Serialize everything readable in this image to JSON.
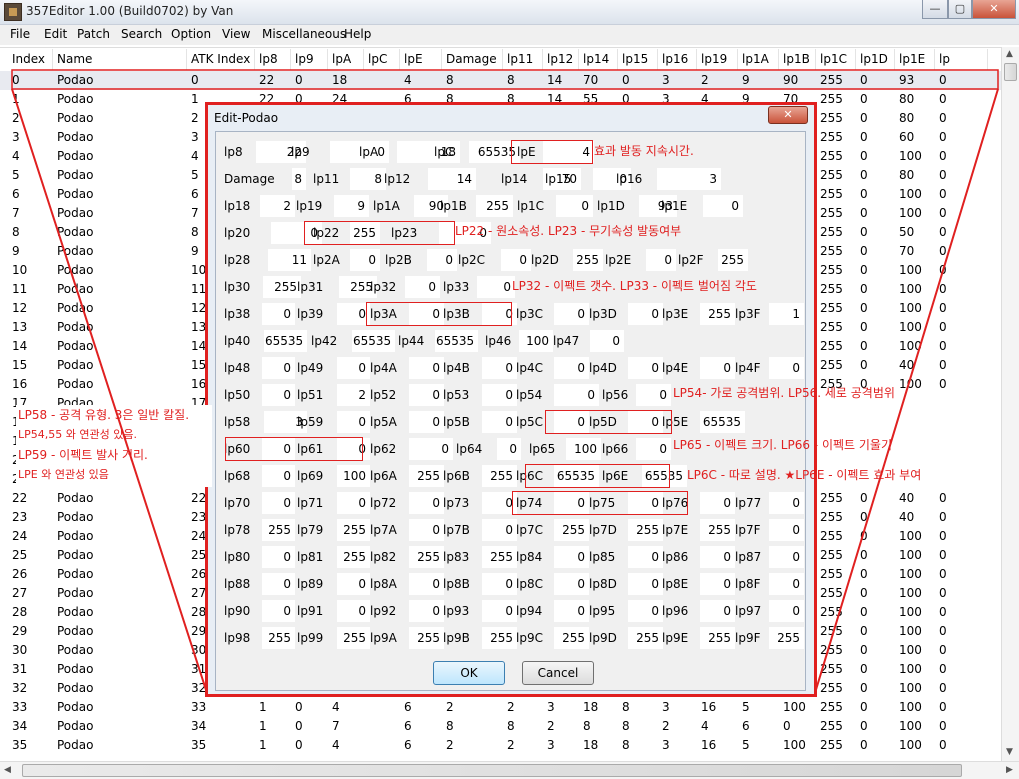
{
  "window": {
    "title": "357Editor 1.00 (Build0702) by Van",
    "min": "—",
    "max": "▢",
    "close": "✕"
  },
  "menu": [
    "File",
    "Edit",
    "Patch",
    "Search",
    "Option",
    "View",
    "Miscellaneous",
    "Help"
  ],
  "table": {
    "columns": [
      "Index",
      "Name",
      "ATK Index",
      "lp8",
      "lp9",
      "lpA",
      "lpC",
      "lpE",
      "Damage",
      "lp11",
      "lp12",
      "lp14",
      "lp15",
      "lp16",
      "lp19",
      "lp1A",
      "lp1B",
      "lp1C",
      "lp1D",
      "lp1E",
      "lp"
    ],
    "rows": [
      [
        "0",
        "Podao",
        "0",
        "22",
        "0",
        "18",
        "",
        "4",
        "8",
        "8",
        "14",
        "70",
        "0",
        "3",
        "2",
        "9",
        "90",
        "255",
        "0",
        "93",
        "0",
        "0"
      ],
      [
        "1",
        "Podao",
        "1",
        "22",
        "0",
        "24",
        "",
        "6",
        "8",
        "8",
        "14",
        "55",
        "0",
        "3",
        "4",
        "9",
        "70",
        "255",
        "0",
        "80",
        "0",
        "0"
      ],
      [
        "2",
        "Podao",
        "2",
        "",
        "",
        "",
        "",
        "",
        "",
        "",
        "",
        "",
        "",
        "",
        "",
        "",
        "",
        "255",
        "0",
        "80",
        "0",
        "0"
      ],
      [
        "3",
        "Podao",
        "3",
        "",
        "",
        "",
        "",
        "",
        "",
        "",
        "",
        "",
        "",
        "",
        "",
        "",
        "",
        "255",
        "0",
        "60",
        "0",
        "0"
      ],
      [
        "4",
        "Podao",
        "4",
        "",
        "",
        "",
        "",
        "",
        "",
        "",
        "",
        "",
        "",
        "",
        "",
        "",
        "",
        "255",
        "0",
        "100",
        "0",
        "0"
      ],
      [
        "5",
        "Podao",
        "5",
        "",
        "",
        "",
        "",
        "",
        "",
        "",
        "",
        "",
        "",
        "",
        "",
        "",
        "",
        "255",
        "0",
        "80",
        "0",
        "0"
      ],
      [
        "6",
        "Podao",
        "6",
        "",
        "",
        "",
        "",
        "",
        "",
        "",
        "",
        "",
        "",
        "",
        "",
        "",
        "",
        "255",
        "0",
        "100",
        "0",
        "0"
      ],
      [
        "7",
        "Podao",
        "7",
        "",
        "",
        "",
        "",
        "",
        "",
        "",
        "",
        "",
        "",
        "",
        "",
        "",
        "",
        "255",
        "0",
        "100",
        "0",
        "0"
      ],
      [
        "8",
        "Podao",
        "8",
        "",
        "",
        "",
        "",
        "",
        "",
        "",
        "",
        "",
        "",
        "",
        "",
        "",
        "",
        "255",
        "0",
        "50",
        "0",
        "0"
      ],
      [
        "9",
        "Podao",
        "9",
        "",
        "",
        "",
        "",
        "",
        "",
        "",
        "",
        "",
        "",
        "",
        "",
        "",
        "",
        "255",
        "0",
        "70",
        "0",
        "0"
      ],
      [
        "10",
        "Podao",
        "10",
        "",
        "",
        "",
        "",
        "",
        "",
        "",
        "",
        "",
        "",
        "",
        "",
        "",
        "",
        "255",
        "0",
        "100",
        "0",
        "0"
      ],
      [
        "11",
        "Podao",
        "11",
        "",
        "",
        "",
        "",
        "",
        "",
        "",
        "",
        "",
        "",
        "",
        "",
        "",
        "",
        "255",
        "0",
        "100",
        "0",
        "0"
      ],
      [
        "12",
        "Podao",
        "12",
        "",
        "",
        "",
        "",
        "",
        "",
        "",
        "",
        "",
        "",
        "",
        "",
        "",
        "",
        "255",
        "0",
        "100",
        "0",
        "0"
      ],
      [
        "13",
        "Podao",
        "13",
        "",
        "",
        "",
        "",
        "",
        "",
        "",
        "",
        "",
        "",
        "",
        "",
        "",
        "",
        "255",
        "0",
        "100",
        "0",
        "0"
      ],
      [
        "14",
        "Podao",
        "14",
        "",
        "",
        "",
        "",
        "",
        "",
        "",
        "",
        "",
        "",
        "",
        "",
        "",
        "",
        "255",
        "0",
        "100",
        "0",
        "0"
      ],
      [
        "15",
        "Podao",
        "15",
        "",
        "",
        "",
        "",
        "",
        "",
        "",
        "",
        "",
        "",
        "",
        "",
        "",
        "",
        "255",
        "0",
        "40",
        "0",
        "0"
      ],
      [
        "16",
        "Podao",
        "16",
        "",
        "",
        "",
        "",
        "",
        "",
        "",
        "",
        "",
        "",
        "",
        "",
        "",
        "",
        "255",
        "0",
        "100",
        "0",
        "0"
      ],
      [
        "17",
        "Podao",
        "17",
        "",
        "",
        "",
        "",
        "",
        "",
        "",
        "",
        "",
        "",
        "",
        "",
        "",
        "",
        "",
        "",
        "",
        "",
        ""
      ],
      [
        "18",
        "Podao",
        "18",
        "",
        "",
        "",
        "",
        "",
        "",
        "",
        "",
        "",
        "",
        "",
        "",
        "",
        "",
        "",
        "",
        "",
        "",
        ""
      ],
      [
        "19",
        "Podao",
        "19",
        "",
        "",
        "",
        "",
        "",
        "",
        "",
        "",
        "",
        "",
        "",
        "",
        "",
        "",
        "",
        "",
        "",
        "",
        ""
      ],
      [
        "20",
        "Podao",
        "20",
        "",
        "",
        "",
        "",
        "",
        "",
        "",
        "",
        "",
        "",
        "",
        "",
        "",
        "",
        "",
        "",
        "",
        "",
        ""
      ],
      [
        "21",
        "Podao",
        "21",
        "",
        "",
        "",
        "",
        "",
        "",
        "",
        "",
        "",
        "",
        "",
        "",
        "",
        "",
        "",
        "",
        "",
        "",
        ""
      ],
      [
        "22",
        "Podao",
        "22",
        "",
        "",
        "",
        "",
        "",
        "",
        "",
        "",
        "",
        "",
        "",
        "",
        "",
        "",
        "255",
        "0",
        "40",
        "0",
        "0"
      ],
      [
        "23",
        "Podao",
        "23",
        "",
        "",
        "",
        "",
        "",
        "",
        "",
        "",
        "",
        "",
        "",
        "",
        "",
        "",
        "255",
        "0",
        "40",
        "0",
        "0"
      ],
      [
        "24",
        "Podao",
        "24",
        "",
        "",
        "",
        "",
        "",
        "",
        "",
        "",
        "",
        "",
        "",
        "",
        "",
        "",
        "255",
        "0",
        "100",
        "0",
        "0"
      ],
      [
        "25",
        "Podao",
        "25",
        "",
        "",
        "",
        "",
        "",
        "",
        "",
        "",
        "",
        "",
        "",
        "",
        "",
        "",
        "255",
        "0",
        "100",
        "0",
        "0"
      ],
      [
        "26",
        "Podao",
        "26",
        "",
        "",
        "",
        "",
        "",
        "",
        "",
        "",
        "",
        "",
        "",
        "",
        "",
        "",
        "255",
        "0",
        "100",
        "0",
        "0"
      ],
      [
        "27",
        "Podao",
        "27",
        "",
        "",
        "",
        "",
        "",
        "",
        "",
        "",
        "",
        "",
        "",
        "",
        "",
        "",
        "255",
        "0",
        "100",
        "0",
        "0"
      ],
      [
        "28",
        "Podao",
        "28",
        "",
        "",
        "",
        "",
        "",
        "",
        "",
        "",
        "",
        "",
        "",
        "",
        "",
        "",
        "255",
        "0",
        "100",
        "0",
        "0"
      ],
      [
        "29",
        "Podao",
        "29",
        "",
        "",
        "",
        "",
        "",
        "",
        "",
        "",
        "",
        "",
        "",
        "",
        "",
        "",
        "255",
        "0",
        "100",
        "0",
        "0"
      ],
      [
        "30",
        "Podao",
        "30",
        "",
        "",
        "",
        "",
        "",
        "",
        "",
        "",
        "",
        "",
        "",
        "",
        "",
        "",
        "255",
        "0",
        "100",
        "0",
        "0"
      ],
      [
        "31",
        "Podao",
        "31",
        "",
        "",
        "",
        "",
        "",
        "",
        "",
        "",
        "",
        "",
        "",
        "",
        "",
        "",
        "255",
        "0",
        "100",
        "0",
        "0"
      ],
      [
        "32",
        "Podao",
        "32",
        "",
        "",
        "",
        "",
        "",
        "",
        "",
        "",
        "",
        "",
        "",
        "",
        "",
        "",
        "255",
        "0",
        "100",
        "0",
        "0"
      ],
      [
        "33",
        "Podao",
        "33",
        "1",
        "0",
        "4",
        "",
        "6",
        "2",
        "2",
        "3",
        "18",
        "8",
        "3",
        "16",
        "5",
        "100",
        "255",
        "0",
        "100",
        "0",
        "18"
      ],
      [
        "34",
        "Podao",
        "34",
        "1",
        "0",
        "7",
        "",
        "6",
        "8",
        "8",
        "2",
        "8",
        "8",
        "2",
        "4",
        "6",
        "0",
        "255",
        "0",
        "100",
        "0",
        "0"
      ],
      [
        "35",
        "Podao",
        "35",
        "1",
        "0",
        "4",
        "",
        "6",
        "2",
        "2",
        "3",
        "18",
        "8",
        "3",
        "16",
        "5",
        "100",
        "255",
        "0",
        "100",
        "0",
        "18"
      ]
    ]
  },
  "dialog": {
    "title": "Edit-Podao",
    "close": "✕",
    "rows": [
      [
        [
          "lp8",
          "22"
        ],
        [
          "lp9",
          "0"
        ],
        [
          "lpA",
          "18"
        ],
        [
          "lpC",
          "65535"
        ],
        [
          "lpE",
          "4"
        ]
      ],
      [
        [
          "Damage",
          "8"
        ],
        [
          "lp11",
          "8"
        ],
        [
          "lp12",
          "14"
        ],
        [
          "lp14",
          "70"
        ],
        [
          "lp15",
          "0"
        ],
        [
          "lp16",
          "3"
        ]
      ],
      [
        [
          "lp18",
          "2"
        ],
        [
          "lp19",
          "9"
        ],
        [
          "lp1A",
          "90"
        ],
        [
          "lp1B",
          "255"
        ],
        [
          "lp1C",
          "0"
        ],
        [
          "lp1D",
          "93"
        ],
        [
          "lp1E",
          "0"
        ]
      ],
      [
        [
          "lp20",
          "0"
        ],
        [
          "lp22",
          "255"
        ],
        [
          "lp23",
          "0"
        ]
      ],
      [
        [
          "lp28",
          "11"
        ],
        [
          "lp2A",
          "0"
        ],
        [
          "lp2B",
          "0"
        ],
        [
          "lp2C",
          "0"
        ],
        [
          "lp2D",
          "255"
        ],
        [
          "lp2E",
          "0"
        ],
        [
          "lp2F",
          "255"
        ]
      ],
      [
        [
          "lp30",
          "255"
        ],
        [
          "lp31",
          "255"
        ],
        [
          "lp32",
          "0"
        ],
        [
          "lp33",
          "0"
        ]
      ],
      [
        [
          "lp38",
          "0"
        ],
        [
          "lp39",
          "0"
        ],
        [
          "lp3A",
          "0"
        ],
        [
          "lp3B",
          "0"
        ],
        [
          "lp3C",
          "0"
        ],
        [
          "lp3D",
          "0"
        ],
        [
          "lp3E",
          "255"
        ],
        [
          "lp3F",
          "1"
        ]
      ],
      [
        [
          "lp40",
          "65535"
        ],
        [
          "lp42",
          "65535"
        ],
        [
          "lp44",
          "65535"
        ],
        [
          "lp46",
          "100"
        ],
        [
          "lp47",
          "0"
        ]
      ],
      [
        [
          "lp48",
          "0"
        ],
        [
          "lp49",
          "0"
        ],
        [
          "lp4A",
          "0"
        ],
        [
          "lp4B",
          "0"
        ],
        [
          "lp4C",
          "0"
        ],
        [
          "lp4D",
          "0"
        ],
        [
          "lp4E",
          "0"
        ],
        [
          "lp4F",
          "0"
        ]
      ],
      [
        [
          "lp50",
          "0"
        ],
        [
          "lp51",
          "2"
        ],
        [
          "lp52",
          "0"
        ],
        [
          "lp53",
          "0"
        ],
        [
          "lp54",
          "0"
        ],
        [
          "lp56",
          "0"
        ]
      ],
      [
        [
          "lp58",
          "3"
        ],
        [
          "lp59",
          "0"
        ],
        [
          "lp5A",
          "0"
        ],
        [
          "lp5B",
          "0"
        ],
        [
          "lp5C",
          "0"
        ],
        [
          "lp5D",
          "0"
        ],
        [
          "lp5E",
          "65535"
        ]
      ],
      [
        [
          "lp60",
          "0"
        ],
        [
          "lp61",
          "0"
        ],
        [
          "lp62",
          "0"
        ],
        [
          "lp64",
          "0"
        ],
        [
          "lp65",
          "100"
        ],
        [
          "lp66",
          "0"
        ]
      ],
      [
        [
          "lp68",
          "0"
        ],
        [
          "lp69",
          "100"
        ],
        [
          "lp6A",
          "255"
        ],
        [
          "lp6B",
          "255"
        ],
        [
          "lp6C",
          "65535"
        ],
        [
          "lp6E",
          "65535"
        ]
      ],
      [
        [
          "lp70",
          "0"
        ],
        [
          "lp71",
          "0"
        ],
        [
          "lp72",
          "0"
        ],
        [
          "lp73",
          "0"
        ],
        [
          "lp74",
          "0"
        ],
        [
          "lp75",
          "0"
        ],
        [
          "lp76",
          "0"
        ],
        [
          "lp77",
          "0"
        ]
      ],
      [
        [
          "lp78",
          "255"
        ],
        [
          "lp79",
          "255"
        ],
        [
          "lp7A",
          "0"
        ],
        [
          "lp7B",
          "0"
        ],
        [
          "lp7C",
          "255"
        ],
        [
          "lp7D",
          "255"
        ],
        [
          "lp7E",
          "255"
        ],
        [
          "lp7F",
          "0"
        ]
      ],
      [
        [
          "lp80",
          "0"
        ],
        [
          "lp81",
          "255"
        ],
        [
          "lp82",
          "255"
        ],
        [
          "lp83",
          "255"
        ],
        [
          "lp84",
          "0"
        ],
        [
          "lp85",
          "0"
        ],
        [
          "lp86",
          "0"
        ],
        [
          "lp87",
          "0"
        ]
      ],
      [
        [
          "lp88",
          "0"
        ],
        [
          "lp89",
          "0"
        ],
        [
          "lp8A",
          "0"
        ],
        [
          "lp8B",
          "0"
        ],
        [
          "lp8C",
          "0"
        ],
        [
          "lp8D",
          "0"
        ],
        [
          "lp8E",
          "0"
        ],
        [
          "lp8F",
          "0"
        ]
      ],
      [
        [
          "lp90",
          "0"
        ],
        [
          "lp91",
          "0"
        ],
        [
          "lp92",
          "0"
        ],
        [
          "lp93",
          "0"
        ],
        [
          "lp94",
          "0"
        ],
        [
          "lp95",
          "0"
        ],
        [
          "lp96",
          "0"
        ],
        [
          "lp97",
          "0"
        ]
      ],
      [
        [
          "lp98",
          "255"
        ],
        [
          "lp99",
          "255"
        ],
        [
          "lp9A",
          "255"
        ],
        [
          "lp9B",
          "255"
        ],
        [
          "lp9C",
          "255"
        ],
        [
          "lp9D",
          "255"
        ],
        [
          "lp9E",
          "255"
        ],
        [
          "lp9F",
          "255"
        ]
      ]
    ],
    "ok": "OK",
    "cancel": "Cancel"
  },
  "notes": {
    "lpE": "효과 발동 지속시간.",
    "lp22_23": "LP22 - 원소속성. LP23 - 무기속성 발동여부",
    "lp32_33": "LP32 - 이펙트 갯수. LP33 - 이펙트 벌어짐 각도",
    "lp54_56": "LP54- 가로 공격범위. LP56. 세로 공격범위",
    "lp65_66": "LP65 - 이펙트 크기. LP66 - 이펙트 기울기",
    "lp6c_6e": "LP6C - 따로 설명. ★LP6E - 이펙트 효과 부여",
    "left1": "LP58 - 공격 유형. 3은 일반 칼질.",
    "left2": "LP54,55 와 연관성 있음.",
    "left3": "LP59 - 이펙트 발사 거리.",
    "left4": "LPE 와 연관성 있음"
  },
  "colors": {
    "annotation": "#e02020"
  }
}
